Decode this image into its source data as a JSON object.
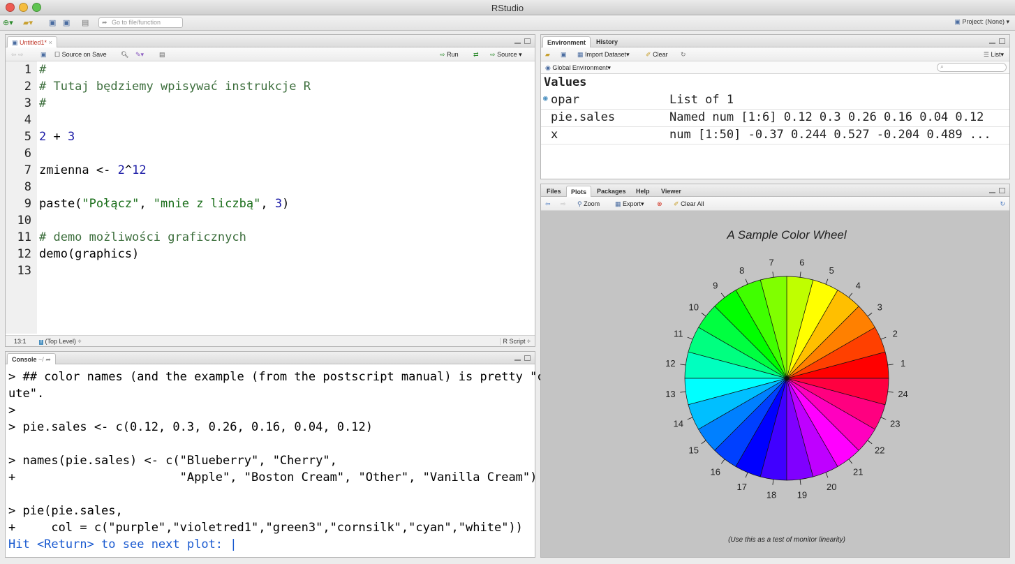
{
  "app": {
    "title": "RStudio",
    "goto_placeholder": "Go to file/function",
    "project": "Project: (None)"
  },
  "editor": {
    "tab": "Untitled1*",
    "source_on_save": "Source on Save",
    "run": "Run",
    "source": "Source",
    "lines": [
      {
        "n": "1",
        "html": "<span class='cm'>#</span>"
      },
      {
        "n": "2",
        "html": "<span class='cm'># Tutaj będziemy wpisywać instrukcje R</span>"
      },
      {
        "n": "3",
        "html": "<span class='cm'>#</span>"
      },
      {
        "n": "4",
        "html": ""
      },
      {
        "n": "5",
        "html": "<span class='nm'>2</span> + <span class='nm'>3</span>"
      },
      {
        "n": "6",
        "html": ""
      },
      {
        "n": "7",
        "html": "zmienna &lt;- <span class='nm'>2</span>^<span class='nm'>12</span>"
      },
      {
        "n": "8",
        "html": ""
      },
      {
        "n": "9",
        "html": "paste(<span class='st'>\"Połącz\"</span>, <span class='st'>\"mnie z liczbą\"</span>, <span class='nm'>3</span>)"
      },
      {
        "n": "10",
        "html": ""
      },
      {
        "n": "11",
        "html": "<span class='cm'># demo możliwości graficznych</span>"
      },
      {
        "n": "12",
        "html": "demo(graphics)"
      },
      {
        "n": "13",
        "html": ""
      }
    ],
    "cursor_pos": "13:1",
    "scope": "(Top Level)",
    "file_type": "R Script"
  },
  "console": {
    "title": "Console",
    "path": "~/",
    "lines": [
      "> ## color names (and the example (from the postscript manual) is pretty \"c",
      "ute\".",
      ">",
      "> pie.sales <- c(0.12, 0.3, 0.26, 0.16, 0.04, 0.12)",
      "",
      "> names(pie.sales) <- c(\"Blueberry\", \"Cherry\",",
      "+                       \"Apple\", \"Boston Cream\", \"Other\", \"Vanilla Cream\")",
      "",
      "> pie(pie.sales,",
      "+     col = c(\"purple\",\"violetred1\",\"green3\",\"cornsilk\",\"cyan\",\"white\"))"
    ],
    "prompt": "Hit <Return> to see next plot: "
  },
  "environment": {
    "tabs": [
      "Environment",
      "History"
    ],
    "import_dataset": "Import Dataset",
    "clear": "Clear",
    "view_mode": "List",
    "scope": "Global Environment",
    "section": "Values",
    "rows": [
      {
        "name": "opar",
        "value": "List of 1"
      },
      {
        "name": "pie.sales",
        "value": "Named num [1:6] 0.12 0.3 0.26 0.16 0.04 0.12"
      },
      {
        "name": "x",
        "value": "num [1:50] -0.37 0.244 0.527 -0.204 0.489 ..."
      }
    ]
  },
  "plots": {
    "tabs": [
      "Files",
      "Plots",
      "Packages",
      "Help",
      "Viewer"
    ],
    "zoom": "Zoom",
    "export": "Export",
    "clear_all": "Clear All"
  },
  "chart_data": {
    "type": "pie",
    "title": "A Sample Color Wheel",
    "subtitle": "(Use this as a test of monitor linearity)",
    "labels": [
      "1",
      "2",
      "3",
      "4",
      "5",
      "6",
      "7",
      "8",
      "9",
      "10",
      "11",
      "12",
      "13",
      "14",
      "15",
      "16",
      "17",
      "18",
      "19",
      "20",
      "21",
      "22",
      "23",
      "24"
    ],
    "values": [
      1,
      1,
      1,
      1,
      1,
      1,
      1,
      1,
      1,
      1,
      1,
      1,
      1,
      1,
      1,
      1,
      1,
      1,
      1,
      1,
      1,
      1,
      1,
      1
    ],
    "colors": "rainbow(24) hue wheel starting at red, counter-clockwise"
  }
}
